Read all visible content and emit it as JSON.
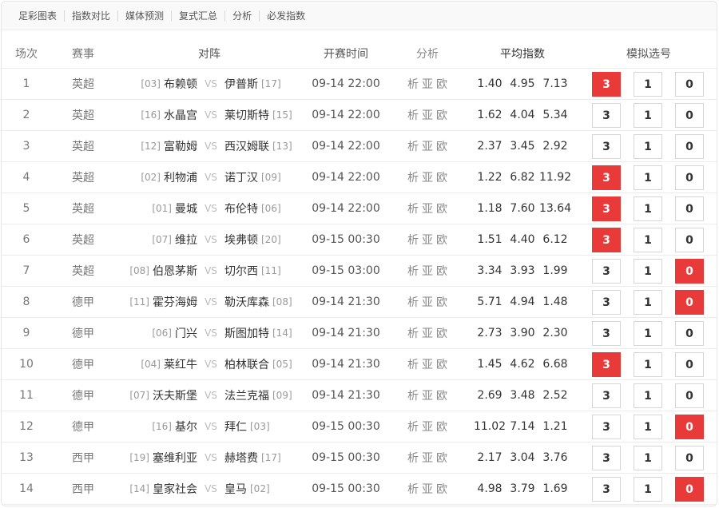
{
  "nav": {
    "tabs": [
      "足彩图表",
      "指数对比",
      "媒体预测",
      "复式汇总",
      "分析",
      "必发指数"
    ]
  },
  "table": {
    "headers": {
      "no": "场次",
      "league": "赛事",
      "match": "对阵",
      "time": "开赛时间",
      "analysis": "分析",
      "odds": "平均指数",
      "pick": "模拟选号"
    },
    "vs_label": "VS",
    "analysis_links": [
      "析",
      "亚",
      "欧"
    ],
    "pick_labels": [
      "3",
      "1",
      "0"
    ],
    "accent_color": "#e93a3a",
    "rows": [
      {
        "no": "1",
        "league": "英超",
        "home_rank": "[03]",
        "home": "布赖顿",
        "away": "伊普斯",
        "away_rank": "[17]",
        "time": "09-14 22:00",
        "odds": [
          "1.40",
          "4.95",
          "7.13"
        ],
        "selected": [
          "3"
        ]
      },
      {
        "no": "2",
        "league": "英超",
        "home_rank": "[16]",
        "home": "水晶宫",
        "away": "莱切斯特",
        "away_rank": "[15]",
        "time": "09-14 22:00",
        "odds": [
          "1.62",
          "4.04",
          "5.34"
        ],
        "selected": []
      },
      {
        "no": "3",
        "league": "英超",
        "home_rank": "[12]",
        "home": "富勒姆",
        "away": "西汉姆联",
        "away_rank": "[13]",
        "time": "09-14 22:00",
        "odds": [
          "2.37",
          "3.45",
          "2.92"
        ],
        "selected": []
      },
      {
        "no": "4",
        "league": "英超",
        "home_rank": "[02]",
        "home": "利物浦",
        "away": "诺丁汉",
        "away_rank": "[09]",
        "time": "09-14 22:00",
        "odds": [
          "1.22",
          "6.82",
          "11.92"
        ],
        "selected": [
          "3"
        ]
      },
      {
        "no": "5",
        "league": "英超",
        "home_rank": "[01]",
        "home": "曼城",
        "away": "布伦特",
        "away_rank": "[06]",
        "time": "09-14 22:00",
        "odds": [
          "1.18",
          "7.60",
          "13.64"
        ],
        "selected": [
          "3"
        ]
      },
      {
        "no": "6",
        "league": "英超",
        "home_rank": "[07]",
        "home": "维拉",
        "away": "埃弗顿",
        "away_rank": "[20]",
        "time": "09-15 00:30",
        "odds": [
          "1.51",
          "4.40",
          "6.12"
        ],
        "selected": [
          "3"
        ]
      },
      {
        "no": "7",
        "league": "英超",
        "home_rank": "[08]",
        "home": "伯恩茅斯",
        "away": "切尔西",
        "away_rank": "[11]",
        "time": "09-15 03:00",
        "odds": [
          "3.34",
          "3.93",
          "1.99"
        ],
        "selected": [
          "0"
        ]
      },
      {
        "no": "8",
        "league": "德甲",
        "home_rank": "[11]",
        "home": "霍芬海姆",
        "away": "勒沃库森",
        "away_rank": "[08]",
        "time": "09-14 21:30",
        "odds": [
          "5.71",
          "4.94",
          "1.48"
        ],
        "selected": [
          "0"
        ]
      },
      {
        "no": "9",
        "league": "德甲",
        "home_rank": "[06]",
        "home": "门兴",
        "away": "斯图加特",
        "away_rank": "[14]",
        "time": "09-14 21:30",
        "odds": [
          "2.73",
          "3.90",
          "2.30"
        ],
        "selected": []
      },
      {
        "no": "10",
        "league": "德甲",
        "home_rank": "[04]",
        "home": "莱红牛",
        "away": "柏林联合",
        "away_rank": "[05]",
        "time": "09-14 21:30",
        "odds": [
          "1.45",
          "4.62",
          "6.68"
        ],
        "selected": [
          "3"
        ]
      },
      {
        "no": "11",
        "league": "德甲",
        "home_rank": "[07]",
        "home": "沃夫斯堡",
        "away": "法兰克福",
        "away_rank": "[09]",
        "time": "09-14 21:30",
        "odds": [
          "2.69",
          "3.48",
          "2.52"
        ],
        "selected": []
      },
      {
        "no": "12",
        "league": "德甲",
        "home_rank": "[16]",
        "home": "基尔",
        "away": "拜仁",
        "away_rank": "[03]",
        "time": "09-15 00:30",
        "odds": [
          "11.02",
          "7.14",
          "1.21"
        ],
        "selected": [
          "0"
        ]
      },
      {
        "no": "13",
        "league": "西甲",
        "home_rank": "[19]",
        "home": "塞维利亚",
        "away": "赫塔费",
        "away_rank": "[17]",
        "time": "09-15 00:30",
        "odds": [
          "2.17",
          "3.04",
          "3.76"
        ],
        "selected": []
      },
      {
        "no": "14",
        "league": "西甲",
        "home_rank": "[14]",
        "home": "皇家社会",
        "away": "皇马",
        "away_rank": "[02]",
        "time": "09-15 00:30",
        "odds": [
          "4.98",
          "3.79",
          "1.69"
        ],
        "selected": [
          "0"
        ]
      }
    ]
  }
}
